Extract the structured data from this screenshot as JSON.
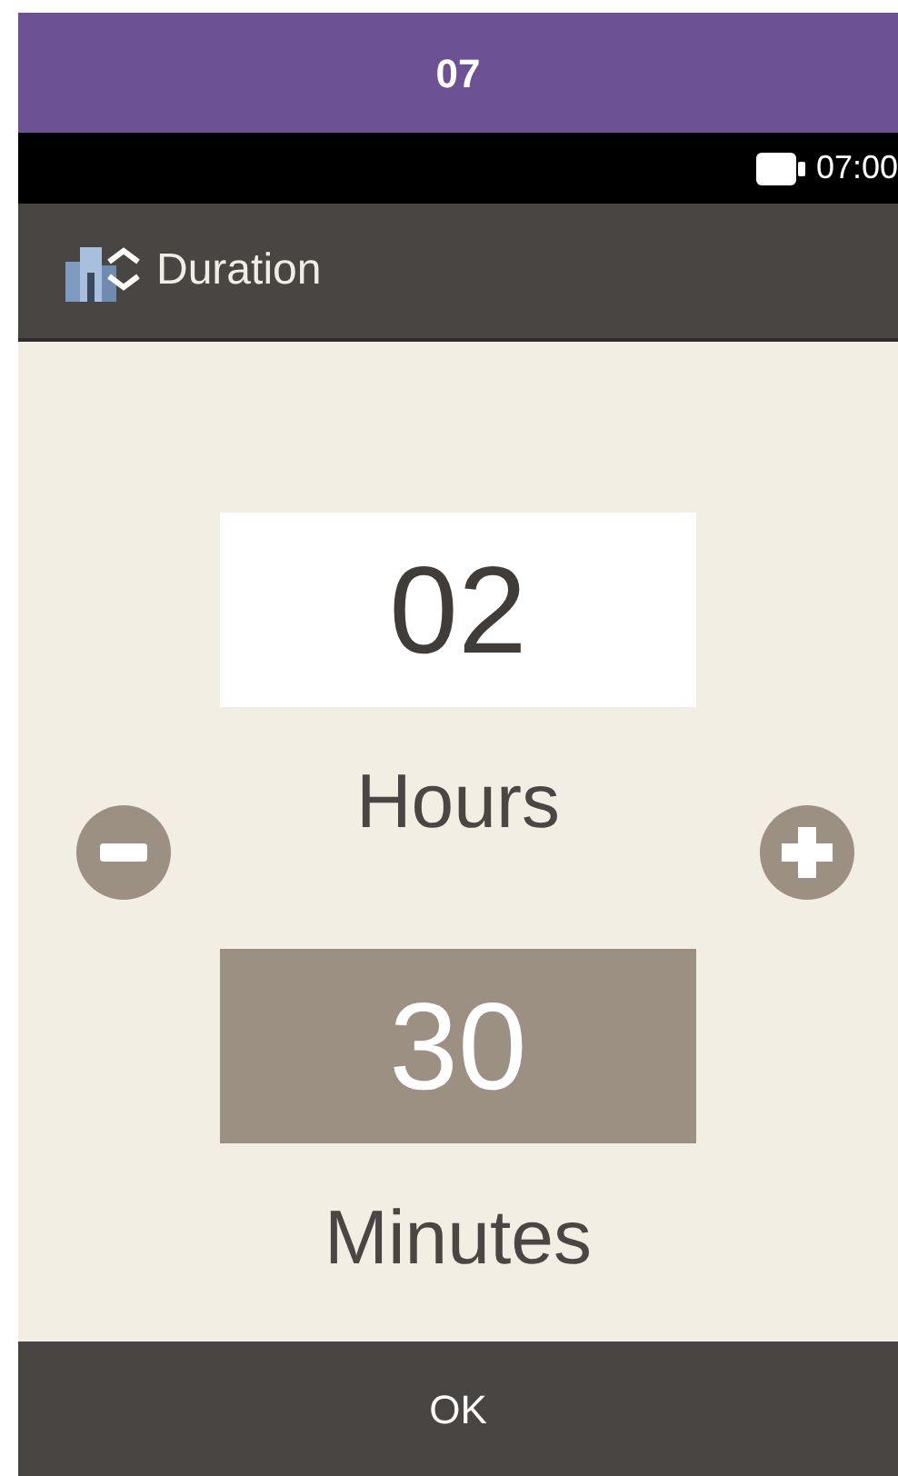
{
  "banner": {
    "title": "07"
  },
  "status_bar": {
    "time": "07:00"
  },
  "header": {
    "title": "Duration"
  },
  "fields": [
    {
      "value": "02",
      "label": "Hours",
      "selected": true
    },
    {
      "value": "30",
      "label": "Minutes",
      "selected": false
    }
  ],
  "footer": {
    "button": "OK"
  }
}
